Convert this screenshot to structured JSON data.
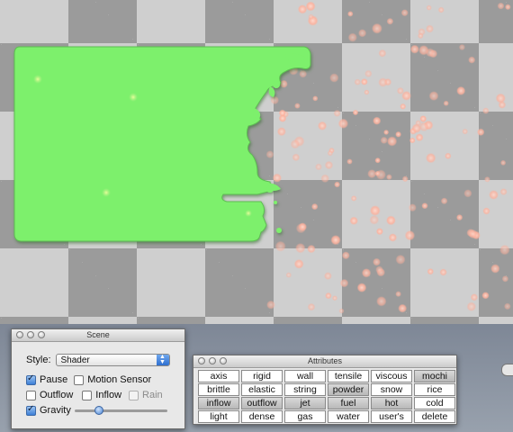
{
  "scene_window": {
    "title": "Scene",
    "style_label": "Style:",
    "style_value": "Shader",
    "pause_label": "Pause",
    "pause_checked": true,
    "motion_sensor_label": "Motion Sensor",
    "motion_sensor_checked": false,
    "outflow_label": "Outflow",
    "outflow_checked": false,
    "inflow_label": "Inflow",
    "inflow_checked": false,
    "rain_label": "Rain",
    "rain_checked": false,
    "rain_enabled": false,
    "gravity_label": "Gravity",
    "gravity_checked": true,
    "gravity_level": 0.24
  },
  "attributes_window": {
    "title": "Attributes",
    "cells": [
      {
        "label": "axis",
        "selected": false
      },
      {
        "label": "rigid",
        "selected": false
      },
      {
        "label": "wall",
        "selected": false
      },
      {
        "label": "tensile",
        "selected": false
      },
      {
        "label": "viscous",
        "selected": false
      },
      {
        "label": "mochi",
        "selected": true
      },
      {
        "label": "brittle",
        "selected": false
      },
      {
        "label": "elastic",
        "selected": false
      },
      {
        "label": "string",
        "selected": false
      },
      {
        "label": "powder",
        "selected": true
      },
      {
        "label": "snow",
        "selected": false
      },
      {
        "label": "rice",
        "selected": false
      },
      {
        "label": "inflow",
        "selected": true
      },
      {
        "label": "outflow",
        "selected": true
      },
      {
        "label": "jet",
        "selected": true
      },
      {
        "label": "fuel",
        "selected": true
      },
      {
        "label": "hot",
        "selected": true
      },
      {
        "label": "cold",
        "selected": false
      },
      {
        "label": "light",
        "selected": false
      },
      {
        "label": "dense",
        "selected": false
      },
      {
        "label": "gas",
        "selected": false
      },
      {
        "label": "water",
        "selected": false
      },
      {
        "label": "user's",
        "selected": false
      },
      {
        "label": "delete",
        "selected": false
      }
    ]
  },
  "colors": {
    "blob": "#7df06c",
    "blob_edge": "#4fa845",
    "particle": "#ffb2a0",
    "checker_light": "#cfcfcf",
    "checker_dark": "#9b9b9b"
  }
}
